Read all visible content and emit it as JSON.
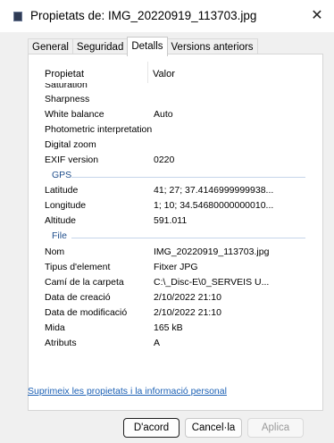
{
  "window": {
    "title": "Propietats de: IMG_20220919_113703.jpg",
    "close_symbol": "✕"
  },
  "tabs": [
    {
      "label": "General",
      "active": false
    },
    {
      "label": "Seguridad",
      "active": false
    },
    {
      "label": "Detalls",
      "active": true
    },
    {
      "label": "Versions anteriors",
      "active": false
    }
  ],
  "list": {
    "header": {
      "name": "Propietat",
      "value": "Valor"
    },
    "clipped_row": {
      "name": "Saturation",
      "value": ""
    },
    "rows_top": [
      {
        "name": "Sharpness",
        "value": ""
      },
      {
        "name": "White balance",
        "value": "Auto"
      },
      {
        "name": "Photometric interpretation",
        "value": ""
      },
      {
        "name": "Digital zoom",
        "value": ""
      },
      {
        "name": "EXIF version",
        "value": "0220"
      }
    ],
    "group_gps": "GPS",
    "rows_gps": [
      {
        "name": "Latitude",
        "value": "41; 27; 37.4146999999938..."
      },
      {
        "name": "Longitude",
        "value": "1; 10; 34.54680000000010..."
      },
      {
        "name": "Altitude",
        "value": "591.011"
      }
    ],
    "group_file": "File",
    "rows_file": [
      {
        "name": "Nom",
        "value": "IMG_20220919_113703.jpg"
      },
      {
        "name": "Tipus d'element",
        "value": "Fitxer JPG"
      },
      {
        "name": "Camí de la carpeta",
        "value": "C:\\_Disc-E\\0_SERVEIS U..."
      },
      {
        "name": "Data de creació",
        "value": "2/10/2022 21:10"
      },
      {
        "name": "Data de modificació",
        "value": "2/10/2022 21:10"
      },
      {
        "name": "Mida",
        "value": "165 kB"
      },
      {
        "name": "Atributs",
        "value": "A"
      }
    ]
  },
  "privacy_link": "Suprimeix les propietats i la informació personal",
  "buttons": {
    "ok": "D'acord",
    "cancel": "Cancel·la",
    "apply": "Aplica"
  }
}
